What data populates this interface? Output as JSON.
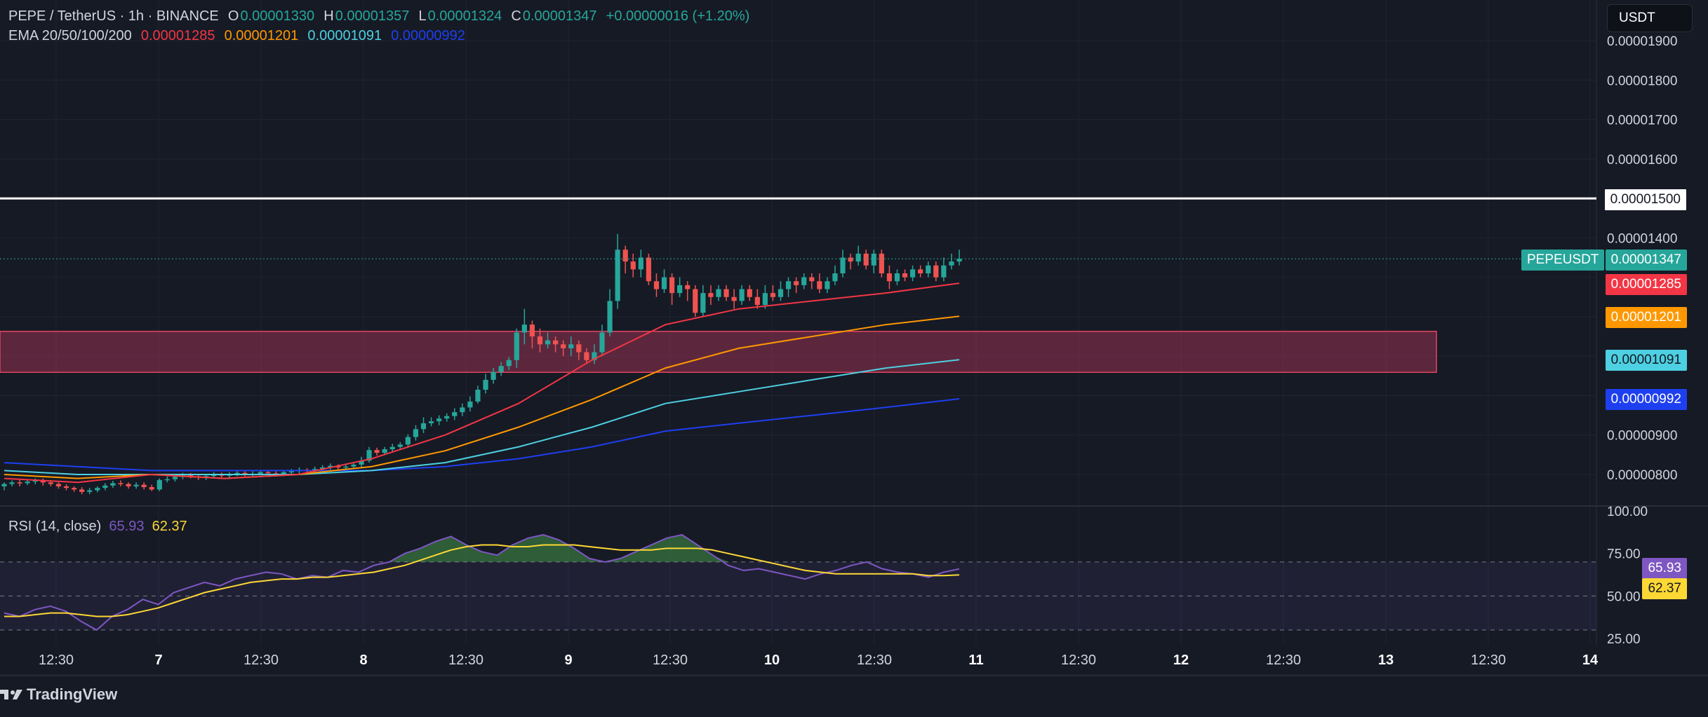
{
  "header": {
    "symbol_line": "PEPE / TetherUS · 1h · BINANCE",
    "o_label": "O",
    "o_value": "0.00001330",
    "h_label": "H",
    "h_value": "0.00001357",
    "l_label": "L",
    "l_value": "0.00001324",
    "c_label": "C",
    "c_value": "0.00001347",
    "change": "+0.00000016 (+1.20%)",
    "ema_label": "EMA 20/50/100/200",
    "ema20": "0.00001285",
    "ema50": "0.00001201",
    "ema100": "0.00001091",
    "ema200": "0.00000992"
  },
  "currency_button": "USDT",
  "rsi": {
    "label": "RSI (14, close)",
    "value": "65.93",
    "ma_value": "62.37"
  },
  "symbol_tag": "PEPEUSDT",
  "price_tags": {
    "resistance": "0.00001500",
    "last": "0.00001347",
    "ema20": "0.00001285",
    "ema50": "0.00001201",
    "ema100": "0.00001091",
    "ema200": "0.00000992"
  },
  "branding": "TradingView",
  "colors": {
    "up": "#26a69a",
    "down": "#ef5350",
    "ema20": "#f23645",
    "ema50": "#ff9800",
    "ema100": "#4dd0e1",
    "ema200": "#1e3ff0",
    "rsi": "#7e57c2",
    "rsi_ma": "#fdd835",
    "zone": "#b2385a"
  },
  "chart_data": {
    "type": "candlestick",
    "price_axis_ticks": [
      "0.00001900",
      "0.00001800",
      "0.00001700",
      "0.00001600",
      "0.00001500",
      "0.00001400",
      "0.00000900",
      "0.00000800"
    ],
    "rsi_axis_ticks": [
      "100.00",
      "75.00",
      "50.00",
      "25.00"
    ],
    "time_ticks": [
      "12:30",
      "7",
      "12:30",
      "8",
      "12:30",
      "9",
      "12:30",
      "10",
      "12:30",
      "11",
      "12:30",
      "12",
      "12:30",
      "13",
      "12:30",
      "14"
    ],
    "resistance_level": 1.5e-05,
    "zone": {
      "low": 1.059e-05,
      "high": 1.163e-05
    },
    "ylim": [
      7.6e-06,
      1.95e-05
    ],
    "candles": [
      [
        7.7e-06,
        7.76e-06,
        7.8e-06,
        7.6e-06
      ],
      [
        7.76e-06,
        7.8e-06,
        7.85e-06,
        7.7e-06
      ],
      [
        7.8e-06,
        7.78e-06,
        7.86e-06,
        7.7e-06
      ],
      [
        7.78e-06,
        7.82e-06,
        7.88e-06,
        7.73e-06
      ],
      [
        7.82e-06,
        7.85e-06,
        7.9e-06,
        7.75e-06
      ],
      [
        7.85e-06,
        7.8e-06,
        7.9e-06,
        7.72e-06
      ],
      [
        7.8e-06,
        7.76e-06,
        7.86e-06,
        7.7e-06
      ],
      [
        7.76e-06,
        7.7e-06,
        7.8e-06,
        7.64e-06
      ],
      [
        7.7e-06,
        7.66e-06,
        7.75e-06,
        7.6e-06
      ],
      [
        7.66e-06,
        7.62e-06,
        7.7e-06,
        7.56e-06
      ],
      [
        7.62e-06,
        7.56e-06,
        7.68e-06,
        7.5e-06
      ],
      [
        7.56e-06,
        7.6e-06,
        7.66e-06,
        7.5e-06
      ],
      [
        7.6e-06,
        7.66e-06,
        7.7e-06,
        7.55e-06
      ],
      [
        7.66e-06,
        7.72e-06,
        7.78e-06,
        7.6e-06
      ],
      [
        7.72e-06,
        7.78e-06,
        7.84e-06,
        7.66e-06
      ],
      [
        7.78e-06,
        7.76e-06,
        7.85e-06,
        7.7e-06
      ],
      [
        7.76e-06,
        7.7e-06,
        7.8e-06,
        7.64e-06
      ],
      [
        7.7e-06,
        7.74e-06,
        7.8e-06,
        7.64e-06
      ],
      [
        7.74e-06,
        7.68e-06,
        7.8e-06,
        7.62e-06
      ],
      [
        7.68e-06,
        7.62e-06,
        7.74e-06,
        7.58e-06
      ],
      [
        7.62e-06,
        7.86e-06,
        7.9e-06,
        7.58e-06
      ],
      [
        7.86e-06,
        7.88e-06,
        7.95e-06,
        7.8e-06
      ],
      [
        7.88e-06,
        7.94e-06,
        8e-06,
        7.82e-06
      ],
      [
        7.94e-06,
        7.98e-06,
        8.04e-06,
        7.88e-06
      ],
      [
        7.98e-06,
        7.95e-06,
        8.04e-06,
        7.9e-06
      ],
      [
        7.95e-06,
        7.92e-06,
        8e-06,
        7.86e-06
      ],
      [
        7.92e-06,
        7.96e-06,
        8e-06,
        7.86e-06
      ],
      [
        7.96e-06,
        8e-06,
        8.06e-06,
        7.9e-06
      ],
      [
        8e-06,
        7.97e-06,
        8.05e-06,
        7.92e-06
      ],
      [
        7.97e-06,
        8.01e-06,
        8.06e-06,
        7.92e-06
      ],
      [
        8.01e-06,
        8.04e-06,
        8.1e-06,
        7.96e-06
      ],
      [
        8.04e-06,
        8e-06,
        8.08e-06,
        7.95e-06
      ],
      [
        8e-06,
        8.02e-06,
        8.08e-06,
        7.95e-06
      ],
      [
        8.02e-06,
        8.06e-06,
        8.1e-06,
        7.98e-06
      ],
      [
        8.06e-06,
        8.03e-06,
        8.1e-06,
        7.98e-06
      ],
      [
        8.03e-06,
        8.01e-06,
        8.08e-06,
        7.96e-06
      ],
      [
        8.01e-06,
        8.06e-06,
        8.1e-06,
        7.96e-06
      ],
      [
        8.06e-06,
        8.08e-06,
        8.14e-06,
        8e-06
      ],
      [
        8.08e-06,
        8.12e-06,
        8.18e-06,
        8.02e-06
      ],
      [
        8.12e-06,
        8.1e-06,
        8.16e-06,
        8.04e-06
      ],
      [
        8.1e-06,
        8.14e-06,
        8.2e-06,
        8.06e-06
      ],
      [
        8.14e-06,
        8.18e-06,
        8.24e-06,
        8.08e-06
      ],
      [
        8.18e-06,
        8.22e-06,
        8.28e-06,
        8.12e-06
      ],
      [
        8.22e-06,
        8.18e-06,
        8.26e-06,
        8.12e-06
      ],
      [
        8.18e-06,
        8.2e-06,
        8.28e-06,
        8.12e-06
      ],
      [
        8.2e-06,
        8.25e-06,
        8.3e-06,
        8.15e-06
      ],
      [
        8.25e-06,
        8.35e-06,
        8.45e-06,
        8.18e-06
      ],
      [
        8.35e-06,
        8.62e-06,
        8.7e-06,
        8.3e-06
      ],
      [
        8.62e-06,
        8.55e-06,
        8.68e-06,
        8.48e-06
      ],
      [
        8.55e-06,
        8.64e-06,
        8.7e-06,
        8.5e-06
      ],
      [
        8.64e-06,
        8.7e-06,
        8.78e-06,
        8.56e-06
      ],
      [
        8.7e-06,
        8.76e-06,
        8.82e-06,
        8.64e-06
      ],
      [
        8.76e-06,
        8.95e-06,
        9.02e-06,
        8.68e-06
      ],
      [
        8.95e-06,
        9.15e-06,
        9.25e-06,
        8.86e-06
      ],
      [
        9.15e-06,
        9.3e-06,
        9.45e-06,
        9.05e-06
      ],
      [
        9.3e-06,
        9.35e-06,
        9.45e-06,
        9.22e-06
      ],
      [
        9.35e-06,
        9.42e-06,
        9.5e-06,
        9.25e-06
      ],
      [
        9.42e-06,
        9.48e-06,
        9.55e-06,
        9.34e-06
      ],
      [
        9.48e-06,
        9.58e-06,
        9.68e-06,
        9.38e-06
      ],
      [
        9.58e-06,
        9.7e-06,
        9.8e-06,
        9.48e-06
      ],
      [
        9.7e-06,
        9.85e-06,
        9.98e-06,
        9.6e-06
      ],
      [
        9.85e-06,
        1.015e-05,
        1.025e-05,
        9.8e-06
      ],
      [
        1.015e-05,
        1.04e-05,
        1.055e-05,
        1.005e-05
      ],
      [
        1.04e-05,
        1.06e-05,
        1.07e-05,
        1.03e-05
      ],
      [
        1.06e-05,
        1.075e-05,
        1.085e-05,
        1.05e-05
      ],
      [
        1.075e-05,
        1.09e-05,
        1.098e-05,
        1.065e-05
      ],
      [
        1.09e-05,
        1.16e-05,
        1.17e-05,
        1.07e-05
      ],
      [
        1.16e-05,
        1.18e-05,
        1.22e-05,
        1.13e-05
      ],
      [
        1.18e-05,
        1.15e-05,
        1.19e-05,
        1.12e-05
      ],
      [
        1.15e-05,
        1.13e-05,
        1.17e-05,
        1.11e-05
      ],
      [
        1.13e-05,
        1.14e-05,
        1.16e-05,
        1.12e-05
      ],
      [
        1.14e-05,
        1.13e-05,
        1.15e-05,
        1.11e-05
      ],
      [
        1.13e-05,
        1.12e-05,
        1.14e-05,
        1.1e-05
      ],
      [
        1.12e-05,
        1.13e-05,
        1.15e-05,
        1.1e-05
      ],
      [
        1.13e-05,
        1.11e-05,
        1.14e-05,
        1.09e-05
      ],
      [
        1.11e-05,
        1.09e-05,
        1.12e-05,
        1.08e-05
      ],
      [
        1.09e-05,
        1.11e-05,
        1.13e-05,
        1.08e-05
      ],
      [
        1.11e-05,
        1.16e-05,
        1.18e-05,
        1.1e-05
      ],
      [
        1.16e-05,
        1.24e-05,
        1.27e-05,
        1.15e-05
      ],
      [
        1.24e-05,
        1.37e-05,
        1.41e-05,
        1.22e-05
      ],
      [
        1.37e-05,
        1.34e-05,
        1.38e-05,
        1.31e-05
      ],
      [
        1.34e-05,
        1.32e-05,
        1.36e-05,
        1.3e-05
      ],
      [
        1.32e-05,
        1.35e-05,
        1.37e-05,
        1.3e-05
      ],
      [
        1.35e-05,
        1.29e-05,
        1.36e-05,
        1.28e-05
      ],
      [
        1.29e-05,
        1.27e-05,
        1.31e-05,
        1.25e-05
      ],
      [
        1.27e-05,
        1.3e-05,
        1.32e-05,
        1.26e-05
      ],
      [
        1.3e-05,
        1.26e-05,
        1.31e-05,
        1.23e-05
      ],
      [
        1.26e-05,
        1.28e-05,
        1.3e-05,
        1.25e-05
      ],
      [
        1.28e-05,
        1.27e-05,
        1.29e-05,
        1.24e-05
      ],
      [
        1.27e-05,
        1.21e-05,
        1.28e-05,
        1.2e-05
      ],
      [
        1.21e-05,
        1.26e-05,
        1.28e-05,
        1.2e-05
      ],
      [
        1.26e-05,
        1.25e-05,
        1.28e-05,
        1.23e-05
      ],
      [
        1.25e-05,
        1.27e-05,
        1.28e-05,
        1.24e-05
      ],
      [
        1.27e-05,
        1.25e-05,
        1.28e-05,
        1.24e-05
      ],
      [
        1.25e-05,
        1.24e-05,
        1.27e-05,
        1.22e-05
      ],
      [
        1.24e-05,
        1.27e-05,
        1.28e-05,
        1.23e-05
      ],
      [
        1.27e-05,
        1.25e-05,
        1.28e-05,
        1.24e-05
      ],
      [
        1.25e-05,
        1.23e-05,
        1.27e-05,
        1.22e-05
      ],
      [
        1.23e-05,
        1.26e-05,
        1.28e-05,
        1.22e-05
      ],
      [
        1.26e-05,
        1.25e-05,
        1.28e-05,
        1.24e-05
      ],
      [
        1.25e-05,
        1.27e-05,
        1.29e-05,
        1.24e-05
      ],
      [
        1.27e-05,
        1.29e-05,
        1.3e-05,
        1.25e-05
      ],
      [
        1.29e-05,
        1.28e-05,
        1.3e-05,
        1.26e-05
      ],
      [
        1.28e-05,
        1.3e-05,
        1.31e-05,
        1.27e-05
      ],
      [
        1.3e-05,
        1.29e-05,
        1.31e-05,
        1.27e-05
      ],
      [
        1.29e-05,
        1.27e-05,
        1.31e-05,
        1.26e-05
      ],
      [
        1.27e-05,
        1.29e-05,
        1.3e-05,
        1.26e-05
      ],
      [
        1.29e-05,
        1.31e-05,
        1.33e-05,
        1.28e-05
      ],
      [
        1.31e-05,
        1.35e-05,
        1.37e-05,
        1.3e-05
      ],
      [
        1.35e-05,
        1.34e-05,
        1.36e-05,
        1.32e-05
      ],
      [
        1.34e-05,
        1.36e-05,
        1.38e-05,
        1.33e-05
      ],
      [
        1.36e-05,
        1.33e-05,
        1.37e-05,
        1.32e-05
      ],
      [
        1.33e-05,
        1.36e-05,
        1.37e-05,
        1.31e-05
      ],
      [
        1.36e-05,
        1.31e-05,
        1.37e-05,
        1.3e-05
      ],
      [
        1.31e-05,
        1.29e-05,
        1.33e-05,
        1.27e-05
      ],
      [
        1.29e-05,
        1.31e-05,
        1.32e-05,
        1.28e-05
      ],
      [
        1.31e-05,
        1.3e-05,
        1.32e-05,
        1.29e-05
      ],
      [
        1.3e-05,
        1.32e-05,
        1.33e-05,
        1.29e-05
      ],
      [
        1.32e-05,
        1.31e-05,
        1.33e-05,
        1.3e-05
      ],
      [
        1.31e-05,
        1.33e-05,
        1.34e-05,
        1.3e-05
      ],
      [
        1.33e-05,
        1.3e-05,
        1.34e-05,
        1.29e-05
      ],
      [
        1.3e-05,
        1.33e-05,
        1.35e-05,
        1.29e-05
      ],
      [
        1.33e-05,
        1.34e-05,
        1.36e-05,
        1.32e-05
      ],
      [
        1.34e-05,
        1.347e-05,
        1.37e-05,
        1.33e-05
      ]
    ],
    "ema20": [
      7.9e-06,
      7.8e-06,
      8e-06,
      7.9e-06,
      8e-06,
      8.4e-06,
      9e-06,
      9.8e-06,
      1.09e-05,
      1.18e-05,
      1.22e-05,
      1.24e-05,
      1.26e-05,
      1.285e-05
    ],
    "ema50": [
      8e-06,
      7.9e-06,
      8e-06,
      7.9e-06,
      8e-06,
      8.2e-06,
      8.6e-06,
      9.2e-06,
      9.9e-06,
      1.07e-05,
      1.12e-05,
      1.15e-05,
      1.18e-05,
      1.201e-05
    ],
    "ema100": [
      8.1e-06,
      8e-06,
      8e-06,
      8e-06,
      8e-06,
      8.1e-06,
      8.3e-06,
      8.7e-06,
      9.2e-06,
      9.8e-06,
      1.01e-05,
      1.04e-05,
      1.07e-05,
      1.091e-05
    ],
    "ema200": [
      8.3e-06,
      8.2e-06,
      8.1e-06,
      8.1e-06,
      8.1e-06,
      8.1e-06,
      8.2e-06,
      8.4e-06,
      8.7e-06,
      9.1e-06,
      9.3e-06,
      9.5e-06,
      9.7e-06,
      9.92e-06
    ],
    "rsi_values": [
      40,
      38,
      42,
      44,
      41,
      35,
      30,
      38,
      42,
      48,
      45,
      52,
      55,
      58,
      56,
      60,
      62,
      64,
      63,
      60,
      62,
      61,
      65,
      64,
      68,
      70,
      75,
      78,
      82,
      85,
      80,
      76,
      74,
      80,
      84,
      86,
      83,
      78,
      72,
      70,
      72,
      76,
      80,
      84,
      86,
      80,
      74,
      68,
      65,
      66,
      64,
      62,
      60,
      63,
      65,
      68,
      70,
      66,
      64,
      63,
      61,
      64,
      65.93
    ],
    "rsi_ma_values": [
      38,
      38,
      39,
      40,
      40,
      39,
      38,
      38,
      39,
      41,
      43,
      46,
      49,
      52,
      54,
      56,
      58,
      59,
      60,
      60,
      61,
      61,
      62,
      63,
      64,
      66,
      68,
      71,
      74,
      77,
      79,
      80,
      80,
      79,
      79,
      80,
      80,
      80,
      79,
      78,
      77,
      77,
      77,
      78,
      78,
      78,
      77,
      75,
      73,
      71,
      69,
      67,
      65,
      64,
      63,
      63,
      63,
      63,
      63,
      63,
      62,
      62,
      62.37
    ],
    "rsi_bands": [
      70,
      50,
      30
    ]
  }
}
